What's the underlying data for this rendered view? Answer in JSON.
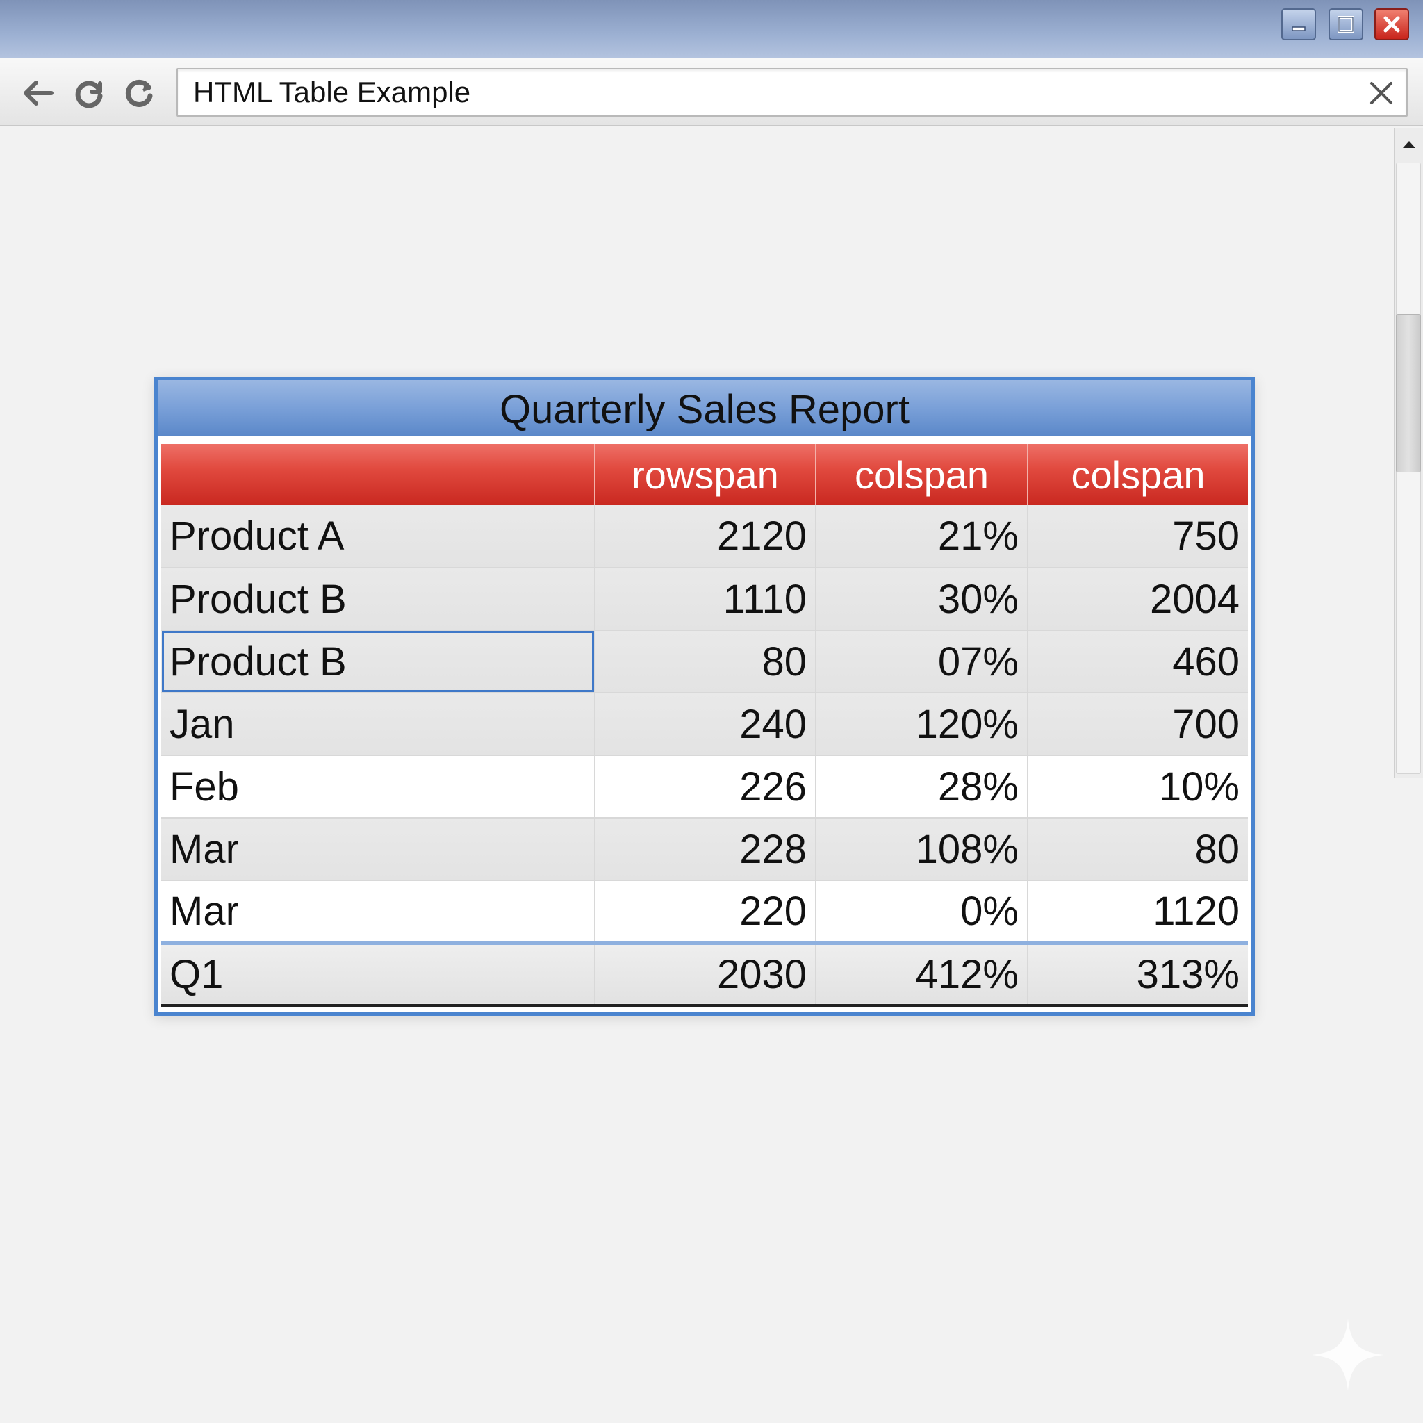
{
  "window": {
    "controls": {
      "minimize_icon": "minimize-icon",
      "maximize_icon": "maximize-icon",
      "close_icon": "close-icon"
    }
  },
  "toolbar": {
    "back_icon": "back-arrow-icon",
    "reload_icon": "reload-icon",
    "address": {
      "value": "HTML Table Example",
      "clear_icon": "close-icon"
    }
  },
  "table": {
    "caption": "Quarterly Sales Report",
    "headers": [
      "",
      "rowspan",
      "colspan",
      "colspan"
    ],
    "rows": [
      [
        "Product A",
        "2120",
        "21%",
        "750"
      ],
      [
        "Product B",
        "1110",
        "30%",
        "2004"
      ],
      [
        "Product B",
        "80",
        "07%",
        "460"
      ],
      [
        "Jan",
        "240",
        "120%",
        "700"
      ],
      [
        "Feb",
        "226",
        "28%",
        "10%"
      ],
      [
        "Mar",
        "228",
        "108%",
        "80"
      ],
      [
        "Mar",
        "220",
        "0%",
        "1120"
      ]
    ],
    "total_row": [
      "Q1",
      "2030",
      "412%",
      "313%"
    ]
  },
  "colors": {
    "table_border": "#4a84cf",
    "header_red": "#d9352b",
    "caption_blue": "#7aa0d8"
  }
}
